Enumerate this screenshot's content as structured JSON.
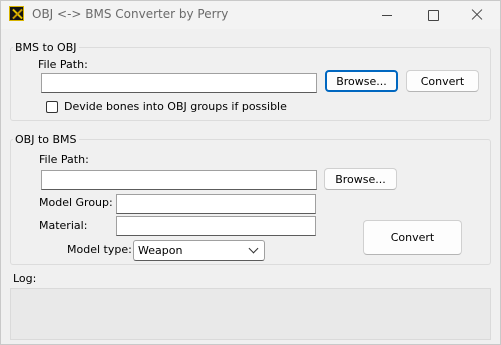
{
  "window": {
    "title": "OBJ <-> BMS Converter by Perry",
    "icon": "app-icon"
  },
  "bms_to_obj": {
    "group_label": "BMS to OBJ",
    "file_path_label": "File Path:",
    "file_path_value": "",
    "browse_label": "Browse...",
    "convert_label": "Convert",
    "checkbox_label": "Devide bones into OBJ groups if possible",
    "checkbox_checked": false
  },
  "obj_to_bms": {
    "group_label": "OBJ to BMS",
    "file_path_label": "File Path:",
    "file_path_value": "",
    "browse_label": "Browse...",
    "model_group_label": "Model Group:",
    "model_group_value": "",
    "material_label": "Material:",
    "material_value": "",
    "model_type_label": "Model type:",
    "model_type_value": "Weapon",
    "convert_label": "Convert"
  },
  "log": {
    "label": "Log:",
    "content": ""
  },
  "colors": {
    "accent": "#0067c0",
    "window_bg": "#f0f0f0"
  }
}
